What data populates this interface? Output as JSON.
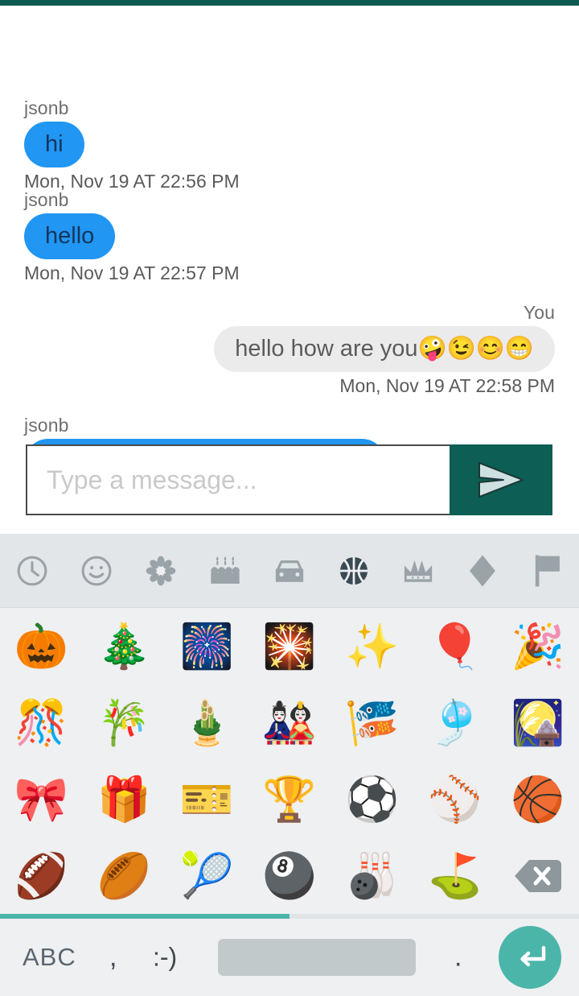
{
  "app": {
    "status_bar_color": "#0b5b52",
    "accent_teal": "#0d5e54",
    "keyboard_accent": "#4cb5aa",
    "incoming_bubble_color": "#2196f3",
    "outgoing_bubble_color": "#ebebeb"
  },
  "chat": {
    "messages": [
      {
        "sender": "jsonb",
        "text": "hi",
        "timestamp": "Mon, Nov 19 AT 22:56 PM",
        "side": "left"
      },
      {
        "sender": "jsonb",
        "text": "hello",
        "timestamp": "Mon, Nov 19 AT 22:57 PM",
        "side": "left"
      },
      {
        "sender": "You",
        "text": "hello how are you🤪😉😊😁",
        "timestamp": "Mon, Nov 19 AT 22:58 PM",
        "side": "right"
      },
      {
        "sender": "jsonb",
        "text": "",
        "timestamp": "",
        "side": "left"
      }
    ]
  },
  "composer": {
    "placeholder": "Type a message...",
    "value": "",
    "send_icon": "send-paper-plane-icon"
  },
  "keyboard": {
    "tabs": [
      {
        "name": "recent",
        "icon": "clock-icon",
        "selected": false
      },
      {
        "name": "smileys",
        "icon": "smiley-icon",
        "selected": false
      },
      {
        "name": "nature",
        "icon": "flower-icon",
        "selected": false
      },
      {
        "name": "food",
        "icon": "cake-icon",
        "selected": false
      },
      {
        "name": "travel",
        "icon": "car-icon",
        "selected": false
      },
      {
        "name": "activity",
        "icon": "basketball-icon",
        "selected": true
      },
      {
        "name": "objects",
        "icon": "crown-icon",
        "selected": false
      },
      {
        "name": "symbols",
        "icon": "diamond-icon",
        "selected": false
      },
      {
        "name": "flags",
        "icon": "flag-icon",
        "selected": false
      }
    ],
    "emojis": [
      {
        "glyph": "🎃",
        "name": "jack-o-lantern"
      },
      {
        "glyph": "🎄",
        "name": "christmas-tree"
      },
      {
        "glyph": "🎆",
        "name": "fireworks"
      },
      {
        "glyph": "🎇",
        "name": "sparkler"
      },
      {
        "glyph": "✨",
        "name": "sparkles"
      },
      {
        "glyph": "🎈",
        "name": "balloon"
      },
      {
        "glyph": "🎉",
        "name": "party-popper"
      },
      {
        "glyph": "🎊",
        "name": "confetti-ball"
      },
      {
        "glyph": "🎋",
        "name": "tanabata-tree"
      },
      {
        "glyph": "🎍",
        "name": "pine-decoration"
      },
      {
        "glyph": "🎎",
        "name": "japanese-dolls"
      },
      {
        "glyph": "🎏",
        "name": "carp-streamer"
      },
      {
        "glyph": "🎐",
        "name": "wind-chime"
      },
      {
        "glyph": "🎑",
        "name": "moon-viewing-ceremony"
      },
      {
        "glyph": "🎀",
        "name": "ribbon"
      },
      {
        "glyph": "🎁",
        "name": "wrapped-gift"
      },
      {
        "glyph": "🎫",
        "name": "ticket"
      },
      {
        "glyph": "🏆",
        "name": "trophy"
      },
      {
        "glyph": "⚽",
        "name": "soccer-ball"
      },
      {
        "glyph": "⚾",
        "name": "baseball"
      },
      {
        "glyph": "🏀",
        "name": "basketball"
      },
      {
        "glyph": "🏈",
        "name": "american-football"
      },
      {
        "glyph": "🏉",
        "name": "rugby-football"
      },
      {
        "glyph": "🎾",
        "name": "tennis"
      },
      {
        "glyph": "🎱",
        "name": "pool-8-ball"
      },
      {
        "glyph": "🎳",
        "name": "bowling"
      },
      {
        "glyph": "⛳",
        "name": "golf-flag-in-hole"
      }
    ],
    "backspace_label": "backspace-key",
    "progress_percent": 50,
    "bottom_row": {
      "abc_label": "ABC",
      "comma_label": ",",
      "emoticon_label": ":-)",
      "space_label": "",
      "period_label": ".",
      "enter_icon": "enter-return-icon"
    }
  }
}
